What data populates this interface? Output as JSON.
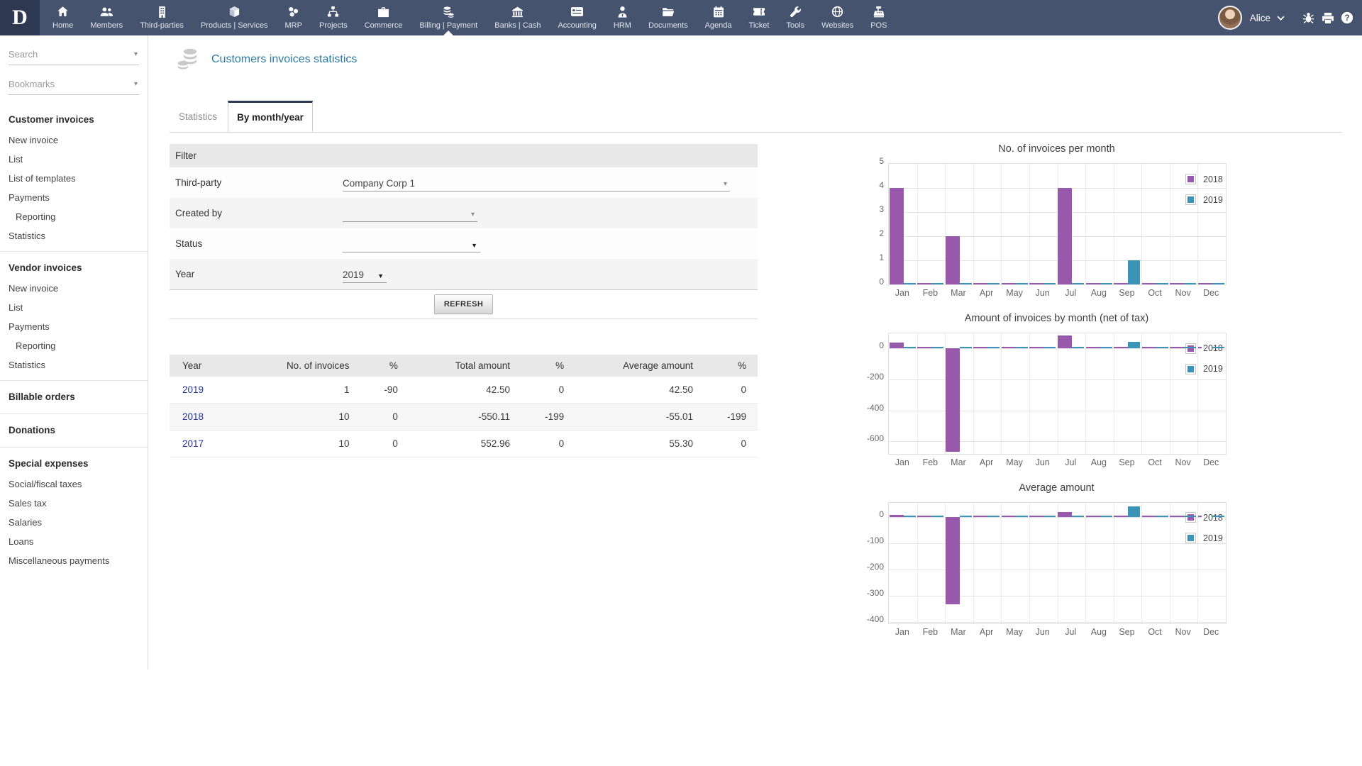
{
  "topbar": {
    "logo": "D",
    "nav": [
      {
        "label": "Home",
        "icon": "home"
      },
      {
        "label": "Members",
        "icon": "members"
      },
      {
        "label": "Third-parties",
        "icon": "third-parties"
      },
      {
        "label": "Products | Services",
        "icon": "products"
      },
      {
        "label": "MRP",
        "icon": "mrp"
      },
      {
        "label": "Projects",
        "icon": "projects"
      },
      {
        "label": "Commerce",
        "icon": "commerce"
      },
      {
        "label": "Billing | Payment",
        "icon": "billing",
        "active": true
      },
      {
        "label": "Banks | Cash",
        "icon": "banks"
      },
      {
        "label": "Accounting",
        "icon": "accounting"
      },
      {
        "label": "HRM",
        "icon": "hrm"
      },
      {
        "label": "Documents",
        "icon": "documents"
      },
      {
        "label": "Agenda",
        "icon": "agenda"
      },
      {
        "label": "Ticket",
        "icon": "ticket"
      },
      {
        "label": "Tools",
        "icon": "tools"
      },
      {
        "label": "Websites",
        "icon": "websites"
      },
      {
        "label": "POS",
        "icon": "pos"
      }
    ],
    "user": {
      "name": "Alice"
    },
    "right_icons": [
      "bug",
      "print",
      "help"
    ]
  },
  "sidebar": {
    "search_placeholder": "Search",
    "bookmarks_placeholder": "Bookmarks",
    "sections": [
      {
        "title": "Customer invoices",
        "items": [
          {
            "label": "New invoice"
          },
          {
            "label": "List"
          },
          {
            "label": "List of templates"
          },
          {
            "label": "Payments"
          },
          {
            "label": "Reporting",
            "indent": true
          },
          {
            "label": "Statistics"
          }
        ]
      },
      {
        "title": "Vendor invoices",
        "items": [
          {
            "label": "New invoice"
          },
          {
            "label": "List"
          },
          {
            "label": "Payments"
          },
          {
            "label": "Reporting",
            "indent": true
          },
          {
            "label": "Statistics"
          }
        ]
      },
      {
        "title": "Billable orders",
        "items": []
      },
      {
        "title": "Donations",
        "items": []
      },
      {
        "title": "Special expenses",
        "items": [
          {
            "label": "Social/fiscal taxes"
          },
          {
            "label": "Sales tax"
          },
          {
            "label": "Salaries"
          },
          {
            "label": "Loans"
          },
          {
            "label": "Miscellaneous payments"
          }
        ]
      }
    ]
  },
  "page": {
    "title": "Customers invoices statistics",
    "tabs": [
      {
        "label": "Statistics",
        "active": false
      },
      {
        "label": "By month/year",
        "active": true
      }
    ]
  },
  "filter": {
    "header": "Filter",
    "third_party_label": "Third-party",
    "third_party_value": "Company Corp 1",
    "created_by_label": "Created by",
    "created_by_value": "",
    "status_label": "Status",
    "status_value": "",
    "year_label": "Year",
    "year_value": "2019",
    "refresh_label": "REFRESH"
  },
  "stats_table": {
    "headers": [
      "Year",
      "No. of invoices",
      "%",
      "Total amount",
      "%",
      "Average amount",
      "%"
    ],
    "percent_columns": [
      2,
      4,
      6
    ],
    "rows": [
      [
        "2019",
        "1",
        "-90",
        "42.50",
        "0",
        "42.50",
        "0"
      ],
      [
        "2018",
        "10",
        "0",
        "-550.11",
        "-199",
        "-55.01",
        "-199"
      ],
      [
        "2017",
        "10",
        "0",
        "552.96",
        "0",
        "55.30",
        "0"
      ]
    ]
  },
  "colors": {
    "topbar": "#46536e",
    "title": "#2d7ba3",
    "series_2018": "#9859ad",
    "series_2019": "#3b93b5",
    "negative": "#e02020",
    "positive": "#23a21f"
  },
  "chart_data": [
    {
      "type": "bar",
      "title": "No. of invoices per month",
      "categories": [
        "Jan",
        "Feb",
        "Mar",
        "Apr",
        "May",
        "Jun",
        "Jul",
        "Aug",
        "Sep",
        "Oct",
        "Nov",
        "Dec"
      ],
      "series": [
        {
          "name": "2018",
          "color": "#9859ad",
          "values": [
            4,
            0,
            2,
            0,
            0,
            0,
            4,
            0,
            0,
            0,
            0,
            0
          ]
        },
        {
          "name": "2019",
          "color": "#3b93b5",
          "values": [
            0,
            0,
            0,
            0,
            0,
            0,
            0,
            0,
            1,
            0,
            0,
            0
          ]
        }
      ],
      "y_ticks": [
        0,
        1,
        2,
        3,
        4,
        5
      ],
      "y_min": 0,
      "y_max": 5,
      "grid": true,
      "legend_position": "top-right"
    },
    {
      "type": "bar",
      "title": "Amount of invoices by month (net of tax)",
      "categories": [
        "Jan",
        "Feb",
        "Mar",
        "Apr",
        "May",
        "Jun",
        "Jul",
        "Aug",
        "Sep",
        "Oct",
        "Nov",
        "Dec"
      ],
      "series": [
        {
          "name": "2018",
          "color": "#9859ad",
          "values": [
            35,
            0,
            -665,
            0,
            0,
            0,
            80,
            0,
            0,
            0,
            0,
            0
          ]
        },
        {
          "name": "2019",
          "color": "#3b93b5",
          "values": [
            0,
            0,
            0,
            0,
            0,
            0,
            0,
            0,
            42.5,
            0,
            0,
            0
          ]
        }
      ],
      "y_ticks": [
        0,
        -200,
        -400,
        -600
      ],
      "y_min": -680,
      "y_max": 95,
      "grid": true,
      "legend_position": "right-at-zero"
    },
    {
      "type": "bar",
      "title": "Average amount",
      "categories": [
        "Jan",
        "Feb",
        "Mar",
        "Apr",
        "May",
        "Jun",
        "Jul",
        "Aug",
        "Sep",
        "Oct",
        "Nov",
        "Dec"
      ],
      "series": [
        {
          "name": "2018",
          "color": "#9859ad",
          "values": [
            8.75,
            0,
            -332.5,
            0,
            0,
            0,
            20,
            0,
            0,
            0,
            0,
            0
          ]
        },
        {
          "name": "2019",
          "color": "#3b93b5",
          "values": [
            0,
            0,
            0,
            0,
            0,
            0,
            0,
            0,
            42.5,
            0,
            0,
            0
          ]
        }
      ],
      "y_ticks": [
        0,
        -100,
        -200,
        -300,
        -400
      ],
      "y_min": -405,
      "y_max": 55,
      "grid": true,
      "legend_position": "right-at-zero"
    }
  ]
}
